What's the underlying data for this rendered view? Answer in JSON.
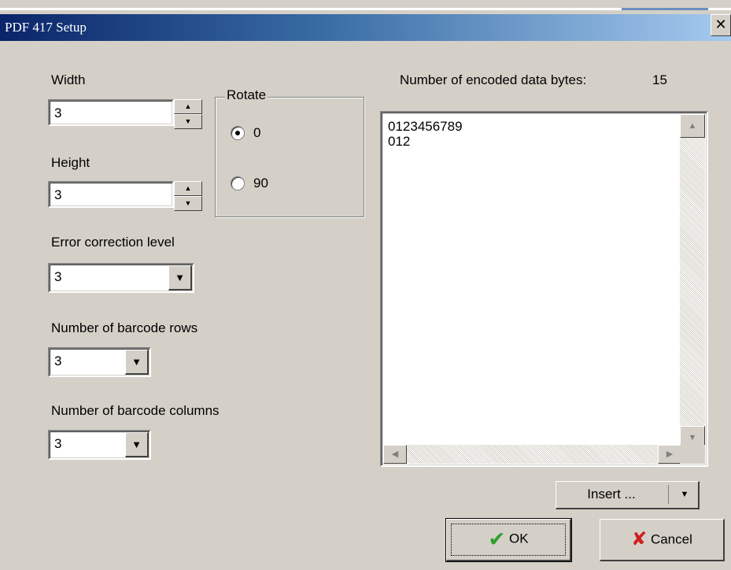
{
  "window": {
    "title": "PDF 417 Setup",
    "close_glyph": "✕"
  },
  "width": {
    "label": "Width",
    "value": "3"
  },
  "height": {
    "label": "Height",
    "value": "3"
  },
  "rotate": {
    "label": "Rotate",
    "options": [
      {
        "label": "0",
        "selected": true
      },
      {
        "label": "90",
        "selected": false
      }
    ]
  },
  "error_correction": {
    "label": "Error correction level",
    "value": "3"
  },
  "barcode_rows": {
    "label": "Number of barcode rows",
    "value": "3"
  },
  "barcode_columns": {
    "label": "Number of barcode columns",
    "value": "3"
  },
  "encoded": {
    "label": "Number of encoded data bytes:",
    "count": "15",
    "text": "0123456789\n012"
  },
  "buttons": {
    "insert": "Insert ...",
    "ok": "OK",
    "cancel": "Cancel"
  },
  "icons": {
    "spin_up": "▲",
    "spin_down": "▼",
    "dropdown": "▼",
    "scroll_up": "▲",
    "scroll_down": "▼",
    "scroll_left": "◀",
    "scroll_right": "▶",
    "ok_check": "✔",
    "cancel_x": "✘"
  },
  "colors": {
    "title_start": "#0a246a",
    "title_end": "#a6caf0",
    "face": "#d4d0c8",
    "ok_check": "#2e9e2e",
    "cancel_x": "#d02020"
  }
}
